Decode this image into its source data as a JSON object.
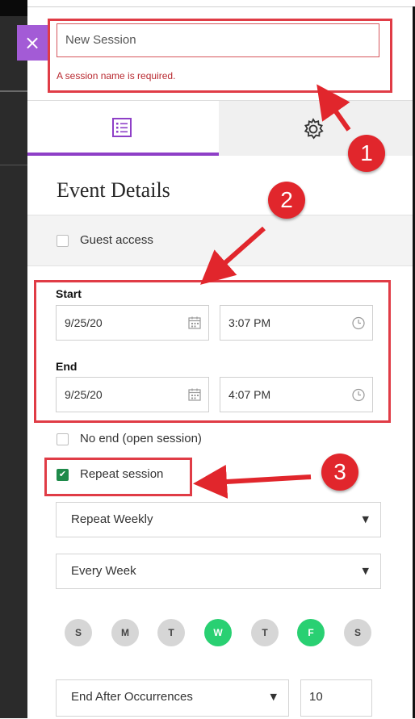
{
  "header": {
    "close_icon": "×",
    "session_name_value": "New Session",
    "error_message": "A session name is required."
  },
  "tabs": [
    {
      "name": "event-details",
      "icon": "list-icon",
      "active": true
    },
    {
      "name": "session-settings",
      "icon": "gear-icon",
      "active": false
    }
  ],
  "section_title": "Event Details",
  "guest_access": {
    "label": "Guest access",
    "checked": false
  },
  "start": {
    "label": "Start",
    "date": "9/25/20",
    "time": "3:07 PM"
  },
  "end": {
    "label": "End",
    "date": "9/25/20",
    "time": "4:07 PM"
  },
  "no_end": {
    "label": "No end (open session)",
    "checked": false
  },
  "repeat_session": {
    "label": "Repeat session",
    "checked": true,
    "check_glyph": "✔"
  },
  "repeat_frequency": {
    "selected": "Repeat Weekly",
    "caret": "▼"
  },
  "repeat_interval": {
    "selected": "Every Week",
    "caret": "▼"
  },
  "days": [
    {
      "letter": "S",
      "selected": false
    },
    {
      "letter": "M",
      "selected": false
    },
    {
      "letter": "T",
      "selected": false
    },
    {
      "letter": "W",
      "selected": true
    },
    {
      "letter": "T",
      "selected": false
    },
    {
      "letter": "F",
      "selected": true
    },
    {
      "letter": "S",
      "selected": false
    }
  ],
  "end_repeat": {
    "selected": "End After Occurrences",
    "caret": "▼",
    "occurrences": "10"
  },
  "callouts": [
    "1",
    "2",
    "3"
  ],
  "colors": {
    "accent": "#8e3fc7",
    "close_bg": "#a35bd6",
    "error": "#b8282f",
    "selected_day": "#29d072",
    "callout": "#e1262c",
    "highlight_border": "#e03c46"
  }
}
